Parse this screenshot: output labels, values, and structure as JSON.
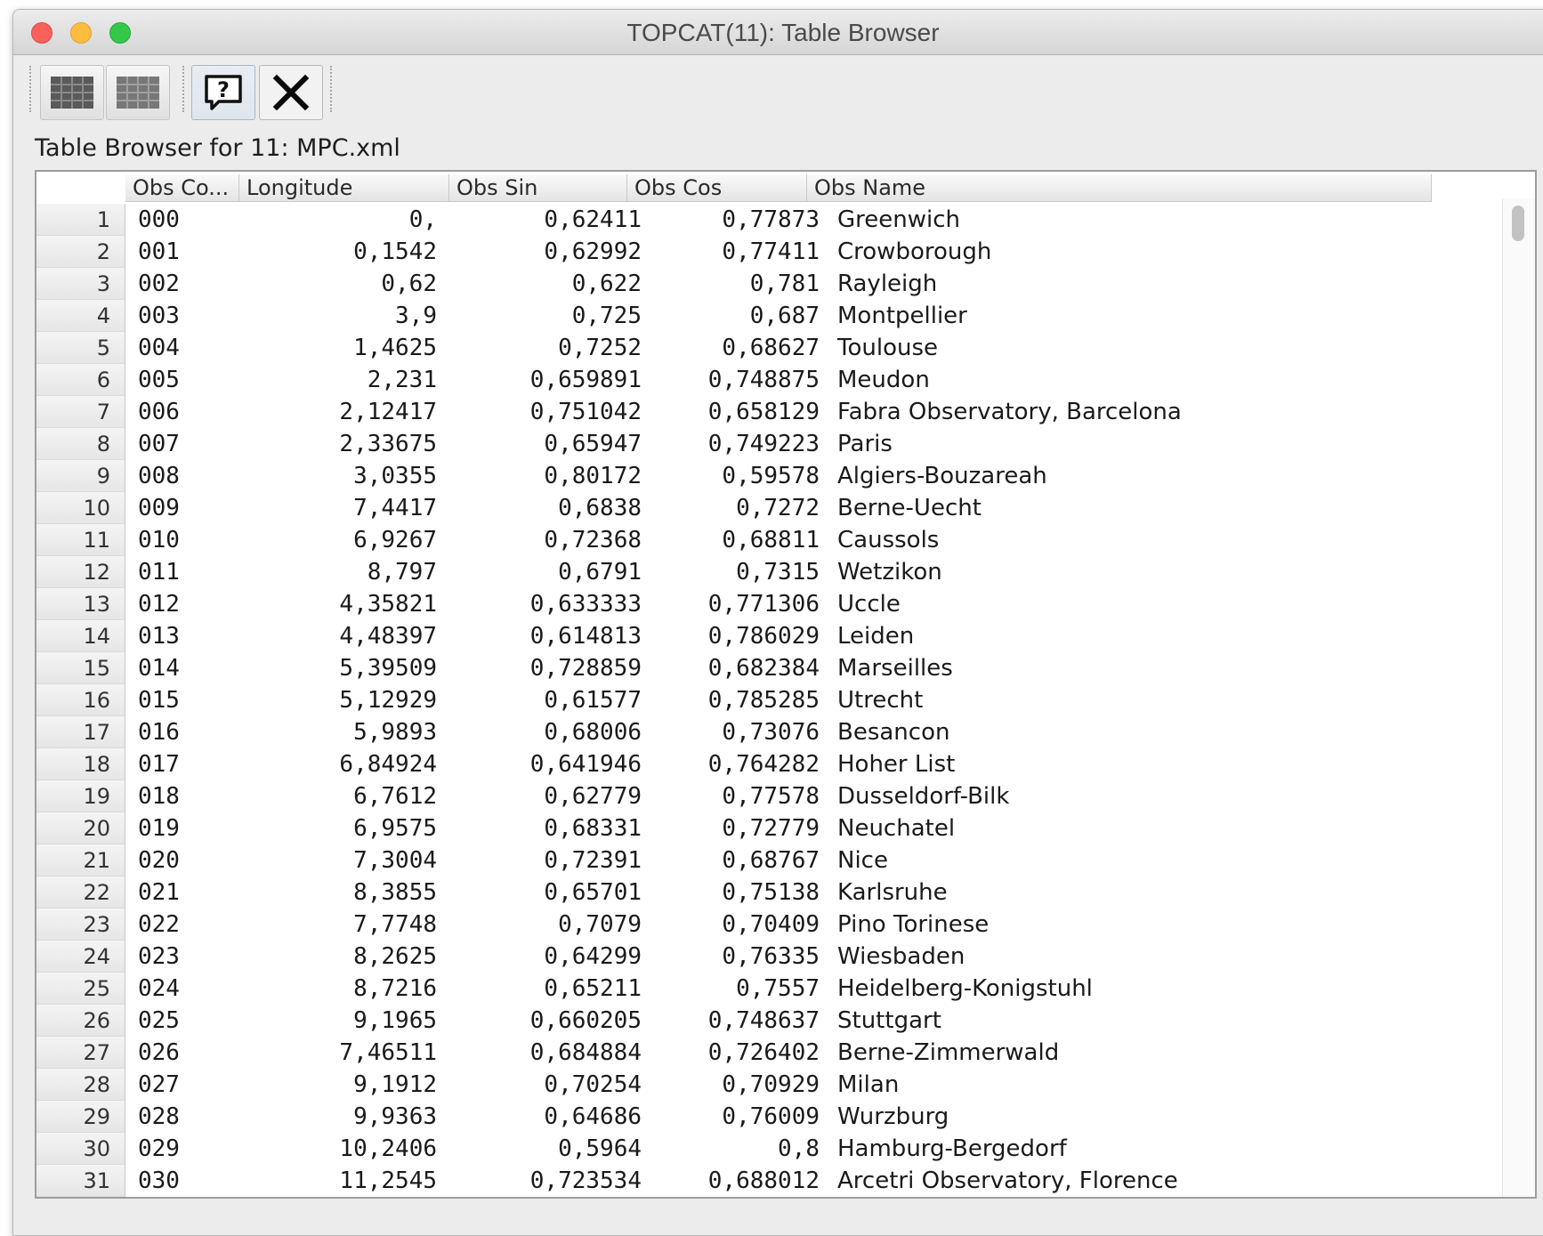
{
  "window": {
    "title": "TOPCAT(11): Table Browser"
  },
  "toolbar": {
    "buttons": [
      {
        "icon": "table-grid-icon",
        "interactive": true
      },
      {
        "icon": "table-grid-disabled-icon",
        "interactive": true
      },
      {
        "icon": "help-icon",
        "interactive": true
      },
      {
        "icon": "close-icon",
        "interactive": true
      }
    ]
  },
  "browser_label": "Table Browser for 11: MPC.xml",
  "table": {
    "columns": [
      "Obs Co...",
      "Longitude",
      "Obs Sin",
      "Obs Cos",
      "Obs Name"
    ],
    "rows": [
      {
        "n": "1",
        "code": "000",
        "lon": "0,",
        "sin": "0,62411",
        "cos": "0,77873",
        "name": "Greenwich"
      },
      {
        "n": "2",
        "code": "001",
        "lon": "0,1542",
        "sin": "0,62992",
        "cos": "0,77411",
        "name": "Crowborough"
      },
      {
        "n": "3",
        "code": "002",
        "lon": "0,62",
        "sin": "0,622",
        "cos": "0,781",
        "name": "Rayleigh"
      },
      {
        "n": "4",
        "code": "003",
        "lon": "3,9",
        "sin": "0,725",
        "cos": "0,687",
        "name": "Montpellier"
      },
      {
        "n": "5",
        "code": "004",
        "lon": "1,4625",
        "sin": "0,7252",
        "cos": "0,68627",
        "name": "Toulouse"
      },
      {
        "n": "6",
        "code": "005",
        "lon": "2,231",
        "sin": "0,659891",
        "cos": "0,748875",
        "name": "Meudon"
      },
      {
        "n": "7",
        "code": "006",
        "lon": "2,12417",
        "sin": "0,751042",
        "cos": "0,658129",
        "name": "Fabra Observatory, Barcelona"
      },
      {
        "n": "8",
        "code": "007",
        "lon": "2,33675",
        "sin": "0,65947",
        "cos": "0,749223",
        "name": "Paris"
      },
      {
        "n": "9",
        "code": "008",
        "lon": "3,0355",
        "sin": "0,80172",
        "cos": "0,59578",
        "name": "Algiers-Bouzareah"
      },
      {
        "n": "10",
        "code": "009",
        "lon": "7,4417",
        "sin": "0,6838",
        "cos": "0,7272",
        "name": "Berne-Uecht"
      },
      {
        "n": "11",
        "code": "010",
        "lon": "6,9267",
        "sin": "0,72368",
        "cos": "0,68811",
        "name": "Caussols"
      },
      {
        "n": "12",
        "code": "011",
        "lon": "8,797",
        "sin": "0,6791",
        "cos": "0,7315",
        "name": "Wetzikon"
      },
      {
        "n": "13",
        "code": "012",
        "lon": "4,35821",
        "sin": "0,633333",
        "cos": "0,771306",
        "name": "Uccle"
      },
      {
        "n": "14",
        "code": "013",
        "lon": "4,48397",
        "sin": "0,614813",
        "cos": "0,786029",
        "name": "Leiden"
      },
      {
        "n": "15",
        "code": "014",
        "lon": "5,39509",
        "sin": "0,728859",
        "cos": "0,682384",
        "name": "Marseilles"
      },
      {
        "n": "16",
        "code": "015",
        "lon": "5,12929",
        "sin": "0,61577",
        "cos": "0,785285",
        "name": "Utrecht"
      },
      {
        "n": "17",
        "code": "016",
        "lon": "5,9893",
        "sin": "0,68006",
        "cos": "0,73076",
        "name": "Besancon"
      },
      {
        "n": "18",
        "code": "017",
        "lon": "6,84924",
        "sin": "0,641946",
        "cos": "0,764282",
        "name": "Hoher List"
      },
      {
        "n": "19",
        "code": "018",
        "lon": "6,7612",
        "sin": "0,62779",
        "cos": "0,77578",
        "name": "Dusseldorf-Bilk"
      },
      {
        "n": "20",
        "code": "019",
        "lon": "6,9575",
        "sin": "0,68331",
        "cos": "0,72779",
        "name": "Neuchatel"
      },
      {
        "n": "21",
        "code": "020",
        "lon": "7,3004",
        "sin": "0,72391",
        "cos": "0,68767",
        "name": "Nice"
      },
      {
        "n": "22",
        "code": "021",
        "lon": "8,3855",
        "sin": "0,65701",
        "cos": "0,75138",
        "name": "Karlsruhe"
      },
      {
        "n": "23",
        "code": "022",
        "lon": "7,7748",
        "sin": "0,7079",
        "cos": "0,70409",
        "name": "Pino Torinese"
      },
      {
        "n": "24",
        "code": "023",
        "lon": "8,2625",
        "sin": "0,64299",
        "cos": "0,76335",
        "name": "Wiesbaden"
      },
      {
        "n": "25",
        "code": "024",
        "lon": "8,7216",
        "sin": "0,65211",
        "cos": "0,7557",
        "name": "Heidelberg-Konigstuhl"
      },
      {
        "n": "26",
        "code": "025",
        "lon": "9,1965",
        "sin": "0,660205",
        "cos": "0,748637",
        "name": "Stuttgart"
      },
      {
        "n": "27",
        "code": "026",
        "lon": "7,46511",
        "sin": "0,684884",
        "cos": "0,726402",
        "name": "Berne-Zimmerwald"
      },
      {
        "n": "28",
        "code": "027",
        "lon": "9,1912",
        "sin": "0,70254",
        "cos": "0,70929",
        "name": "Milan"
      },
      {
        "n": "29",
        "code": "028",
        "lon": "9,9363",
        "sin": "0,64686",
        "cos": "0,76009",
        "name": "Wurzburg"
      },
      {
        "n": "30",
        "code": "029",
        "lon": "10,2406",
        "sin": "0,5964",
        "cos": "0,8",
        "name": "Hamburg-Bergedorf"
      },
      {
        "n": "31",
        "code": "030",
        "lon": "11,2545",
        "sin": "0,723534",
        "cos": "0,688012",
        "name": "Arcetri Observatory, Florence"
      }
    ]
  },
  "colors": {
    "close_red": "#fc605c",
    "minimize_yellow": "#fdbc40",
    "zoom_green": "#34c84a",
    "window_bg": "#ececec"
  }
}
